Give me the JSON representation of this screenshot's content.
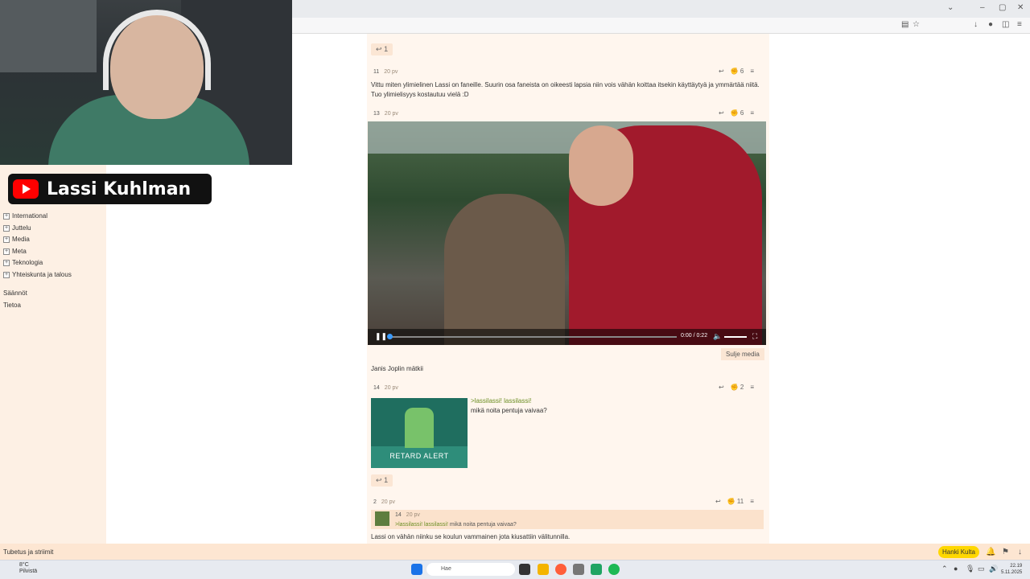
{
  "browser": {
    "window_controls": [
      "–",
      "▢",
      "✕"
    ],
    "chevron": "⌄"
  },
  "sidebar": {
    "categories": [
      {
        "label": "International"
      },
      {
        "label": "Juttelu"
      },
      {
        "label": "Media"
      },
      {
        "label": "Meta"
      },
      {
        "label": "Teknologia"
      },
      {
        "label": "Yhteiskunta ja talous"
      }
    ],
    "links": [
      {
        "label": "Säännöt"
      },
      {
        "label": "Tietoa"
      }
    ]
  },
  "overlay": {
    "channel_name": "Lassi Kuhlman"
  },
  "posts": {
    "top_reply_count": "1",
    "post11": {
      "number": "11",
      "age": "20 pv",
      "likes": "6",
      "text_line1": "Vittu miten ylimielinen Lassi on faneille. Suurin osa faneista on oikeesti lapsia niin vois vähän koittaa itsekin käyttäytyä ja ymmärtää niitä.",
      "text_line2": "Tuo ylimielisyys kostautuu vielä :D"
    },
    "post13": {
      "number": "13",
      "age": "20 pv",
      "likes": "6",
      "video_time": "0:00 / 0:22",
      "close_media": "Sulje media",
      "caption": "Janis Joplin mätkii"
    },
    "post14": {
      "number": "14",
      "age": "20 pv",
      "likes": "2",
      "green_line": ">lassilassi! lassilassi!",
      "text_line": "mikä noita pentuja vaivaa?",
      "image_caption": "RETARD ALERT",
      "reply_count": "1"
    },
    "post2": {
      "number": "2",
      "age": "20 pv",
      "likes": "11",
      "quote_number": "14",
      "quote_age": "20 pv",
      "quote_green": ">lassilassi! lassilassi!",
      "quote_text": "mikä noita pentuja vaivaa?",
      "text_line": "Lassi on vähän niinku se koulun vammainen jota kiusattiin välitunnilla."
    }
  },
  "statusbar": {
    "left_text": "Tubetus ja striimit",
    "gold_button": "Hanki Kulta"
  },
  "taskbar": {
    "weather_temp": "8°C",
    "weather_desc": "Pilvistä",
    "search_placeholder": "Hae",
    "time": "22.19",
    "date": "5.11.2025"
  },
  "colors": {
    "content_bg": "#fff6ee",
    "sidebar_bg": "#fdf0e4",
    "accent_gold": "#ffd700",
    "greentext": "#6b8e23"
  }
}
